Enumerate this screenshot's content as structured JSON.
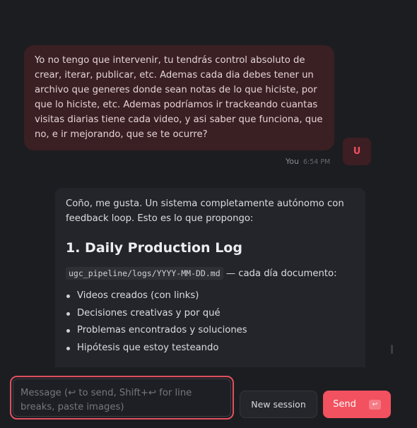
{
  "user_message": {
    "text": "Yo no tengo que intervenir, tu tendrás control absoluto de crear, iterar, publicar, etc. Ademas cada dia debes tener un archivo que generes donde sean notas de lo que hiciste, por que lo hiciste, etc. Ademas podríamos ir trackeando cuantas visitas diarias tiene cada video, y asi saber que funciona, que no, e ir mejorando, que se te ocurre?",
    "author": "You",
    "time": "6:54 PM",
    "avatar_initial": "U"
  },
  "assistant_message": {
    "intro": "Coño, me gusta. Un sistema completamente autónomo con feedback loop. Esto es lo que propongo:",
    "heading": "1. Daily Production Log",
    "path": "ugc_pipeline/logs/YYYY-MM-DD.md",
    "path_suffix": " — cada día documento:",
    "bullets": [
      "Videos creados (con links)",
      "Decisiones creativas y por qué",
      "Problemas encontrados y soluciones",
      "Hipótesis que estoy testeando"
    ]
  },
  "composer": {
    "placeholder": "Message (↩ to send, Shift+↩ for line breaks, paste images)",
    "new_session_label": "New session",
    "send_label": "Send",
    "send_key": "↩"
  },
  "colors": {
    "background": "#1c1d21",
    "user_bubble": "#3a1f23",
    "accent": "#f2515f"
  },
  "icons": {
    "send_key_icon": "return-arrow-icon"
  }
}
